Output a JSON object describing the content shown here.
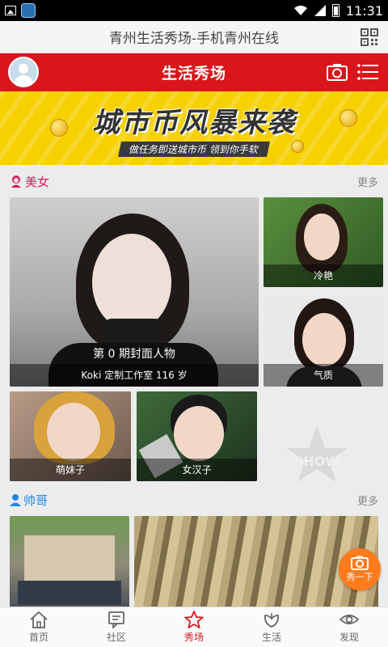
{
  "status_bar": {
    "time": "11:31"
  },
  "title_bar": {
    "title": "青州生活秀场-手机青州在线"
  },
  "header": {
    "title": "生活秀场"
  },
  "banner": {
    "headline": "城市币风暴来袭",
    "subline": "做任务即送城市币 领到你手软"
  },
  "beauty_section": {
    "label": "美女",
    "more": "更多",
    "featured": {
      "issue": "第 0 期封面人物",
      "caption": "Koki 定制工作室 116 岁"
    },
    "tiles": [
      {
        "caption": "冷艳"
      },
      {
        "caption": "气质"
      },
      {
        "caption": "萌妹子"
      },
      {
        "caption": "女汉子"
      }
    ]
  },
  "handsome_section": {
    "label": "帅哥",
    "more": "更多"
  },
  "fab": {
    "label": "秀一下"
  },
  "tabs": [
    {
      "label": "首页",
      "icon": "home-icon"
    },
    {
      "label": "社区",
      "icon": "community-icon"
    },
    {
      "label": "秀场",
      "icon": "star-icon",
      "active": true
    },
    {
      "label": "生活",
      "icon": "life-icon"
    },
    {
      "label": "发现",
      "icon": "eye-icon"
    }
  ],
  "colors": {
    "brand_red": "#d9161c",
    "fab_orange": "#ff7b1c",
    "beauty_pink": "#d81b60",
    "handsome_blue": "#1e88e5"
  }
}
